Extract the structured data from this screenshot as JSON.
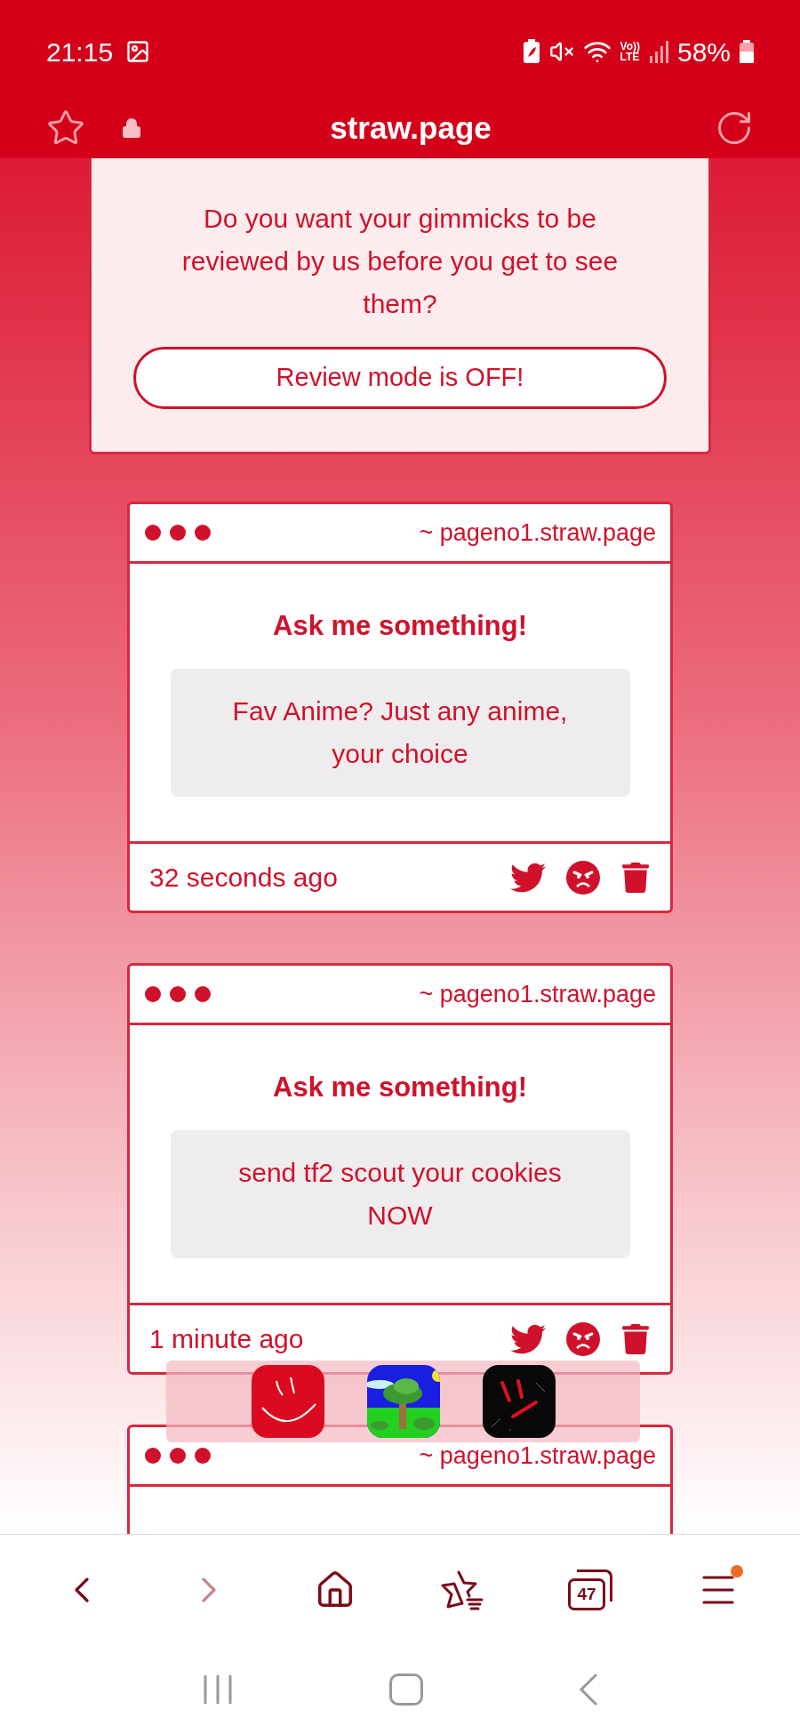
{
  "status_bar": {
    "time": "21:15",
    "network_label": [
      "Vo))",
      "LTE"
    ],
    "battery": "58%"
  },
  "toolbar": {
    "url": "straw.page"
  },
  "review_panel": {
    "text": "Do you want your gimmicks to be reviewed by us before you get to see them?",
    "button": "Review mode is OFF!"
  },
  "cards": [
    {
      "site": "~ pageno1.straw.page",
      "title": "Ask me something!",
      "question": "Fav Anime? Just any anime, your choice",
      "time": "32 seconds ago"
    },
    {
      "site": "~ pageno1.straw.page",
      "title": "Ask me something!",
      "question": "send tf2 scout your cookies NOW",
      "time": "1 minute ago"
    },
    {
      "site": "~ pageno1.straw.page"
    }
  ],
  "bottom_nav": {
    "tab_count": "47",
    "menu_badge": true
  }
}
